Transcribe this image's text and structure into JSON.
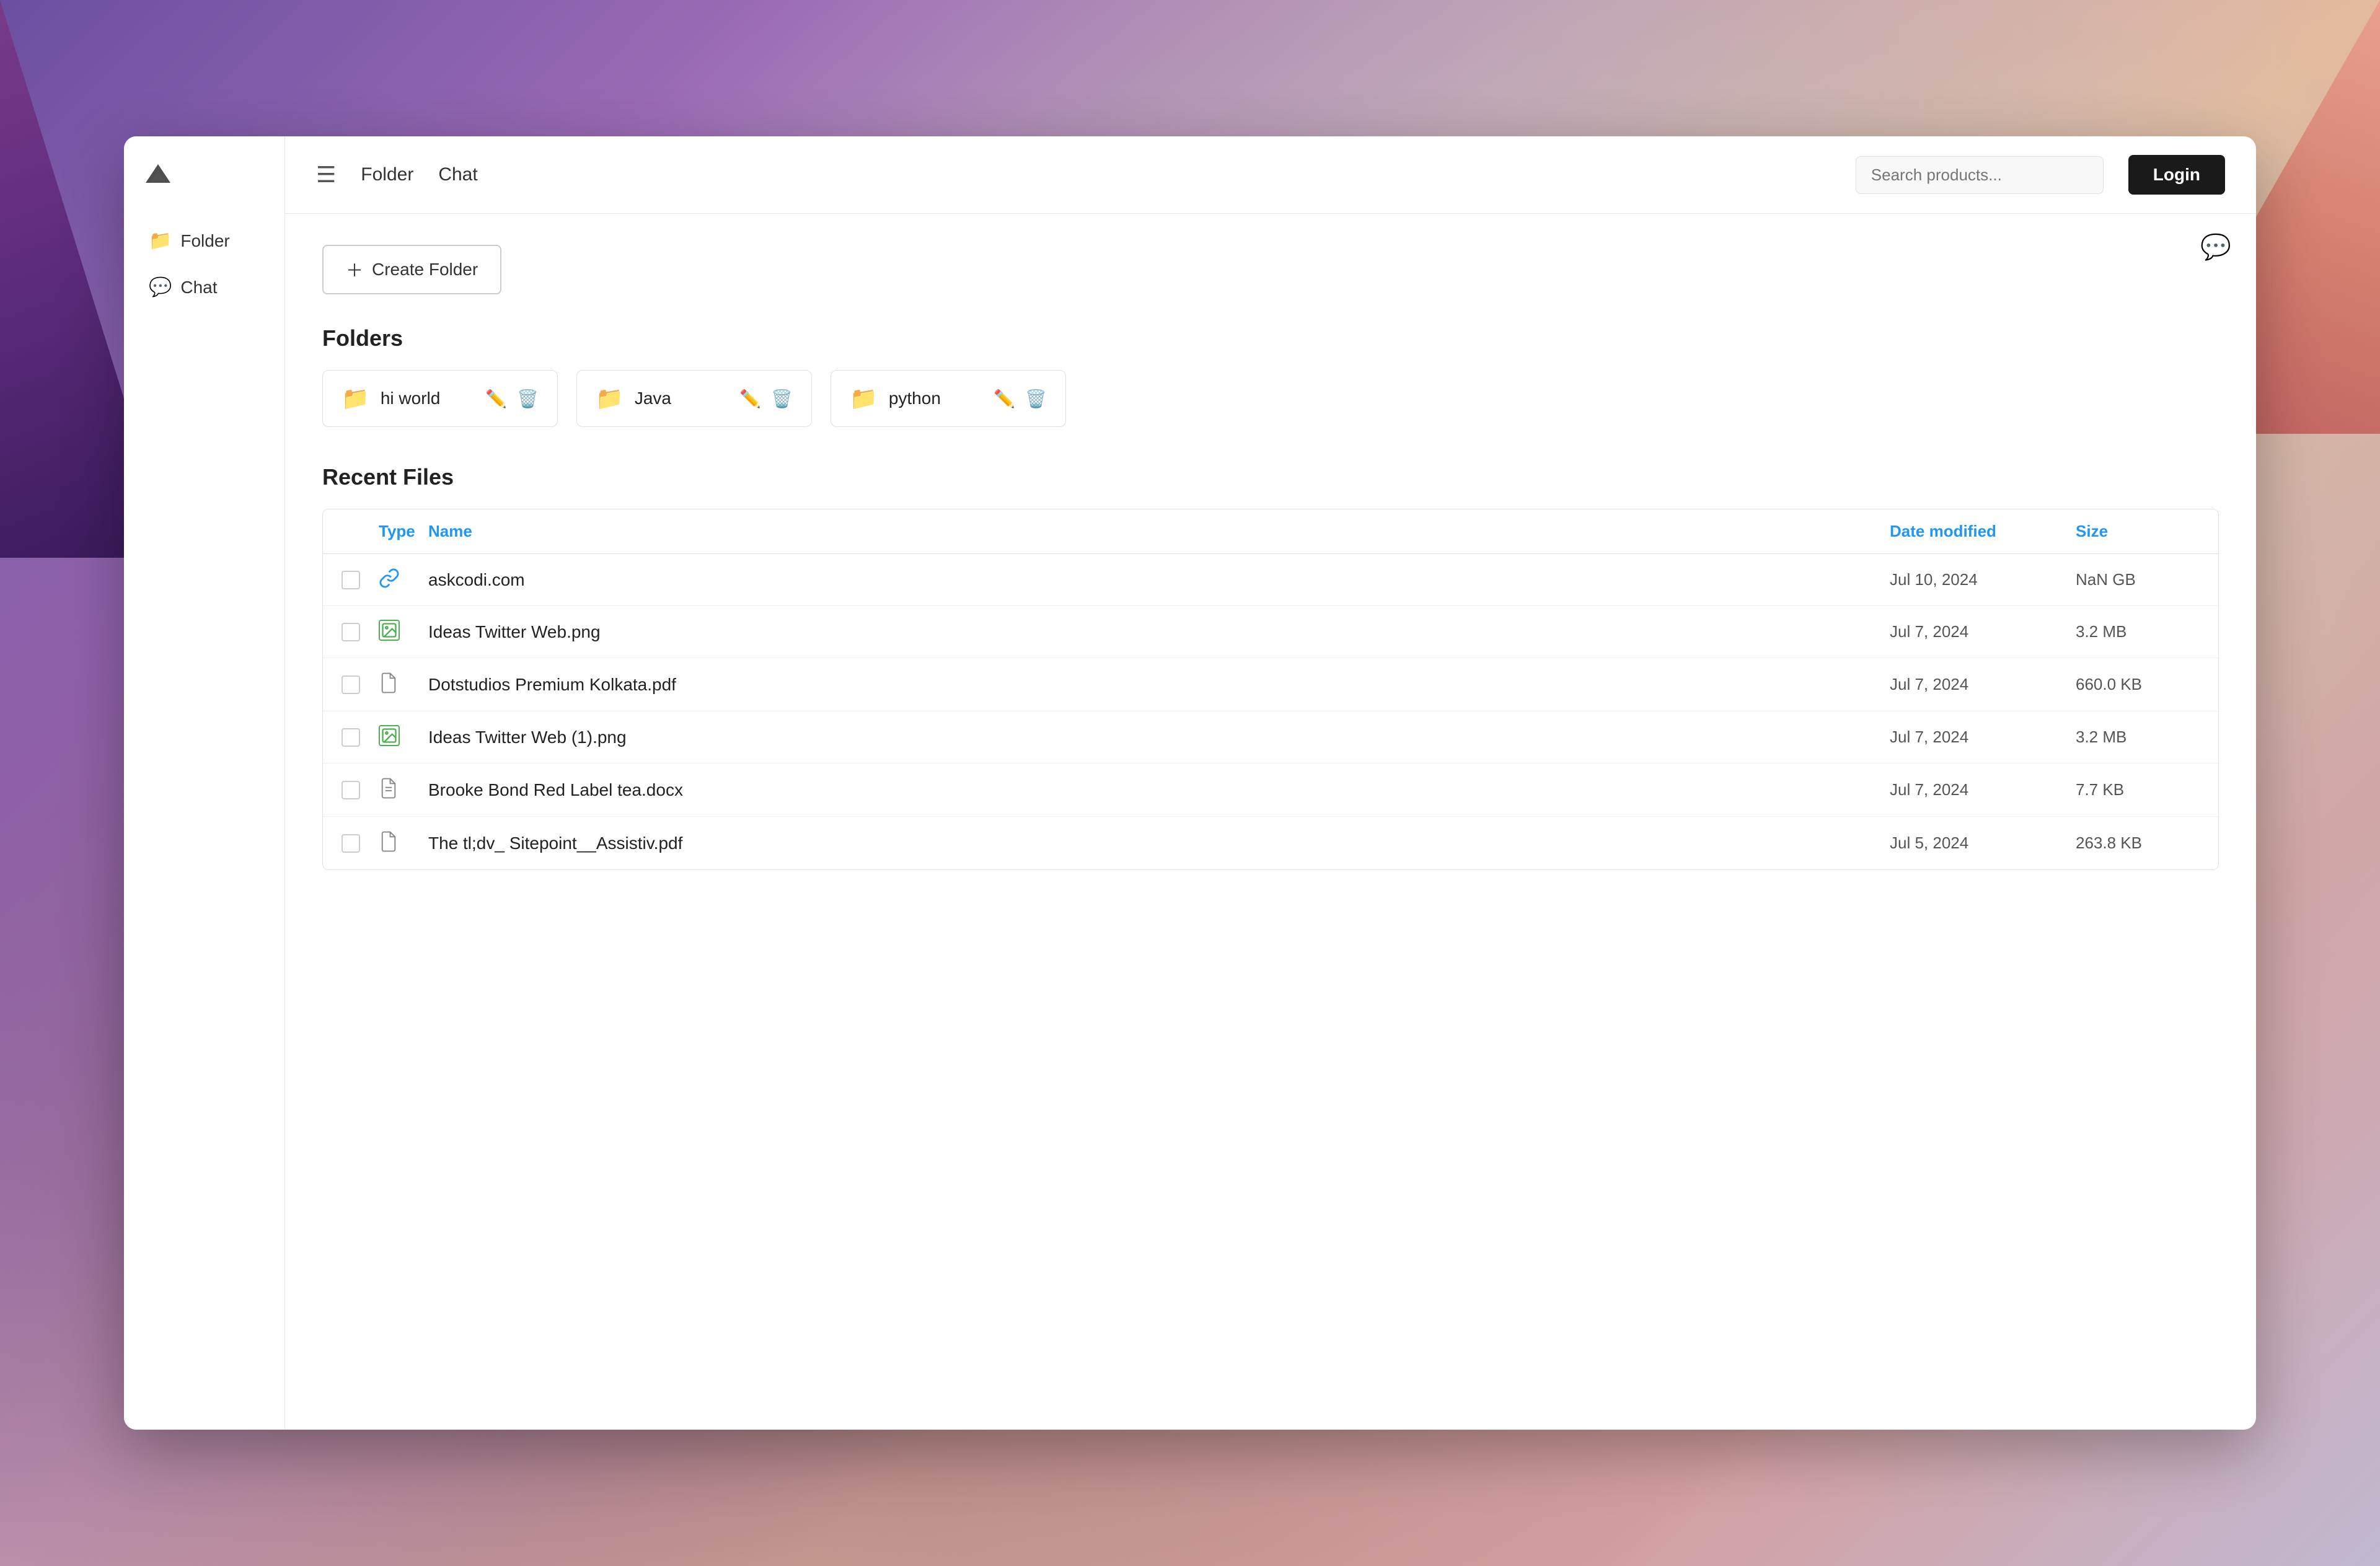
{
  "background": {
    "sky_color_top": "#8bbcbc",
    "sky_color_bottom": "#b8d4c0"
  },
  "app": {
    "logo_alt": "Mountain logo"
  },
  "sidebar": {
    "items": [
      {
        "id": "folder",
        "label": "Folder",
        "icon": "📁"
      },
      {
        "id": "chat",
        "label": "Chat",
        "icon": "💬"
      }
    ]
  },
  "header": {
    "menu_icon": "☰",
    "nav_items": [
      {
        "id": "folder",
        "label": "Folder"
      },
      {
        "id": "chat",
        "label": "Chat"
      }
    ],
    "search_placeholder": "Search products...",
    "login_label": "Login"
  },
  "page": {
    "chat_float_icon": "💬",
    "create_folder_label": "Create Folder",
    "folders_section_title": "Folders",
    "folders": [
      {
        "id": "hi-world",
        "name": "hi world",
        "icon": "📁"
      },
      {
        "id": "java",
        "name": "Java",
        "icon": "📁"
      },
      {
        "id": "python",
        "name": "python",
        "icon": "📁"
      }
    ],
    "recent_files_title": "Recent Files",
    "table_headers": {
      "type": "Type",
      "name": "Name",
      "date_modified": "Date modified",
      "size": "Size"
    },
    "files": [
      {
        "id": 1,
        "type": "link",
        "name": "askcodi.com",
        "date": "Jul 10, 2024",
        "size": "NaN GB"
      },
      {
        "id": 2,
        "type": "image",
        "name": "Ideas Twitter Web.png",
        "date": "Jul 7, 2024",
        "size": "3.2 MB"
      },
      {
        "id": 3,
        "type": "pdf",
        "name": "Dotstudios Premium Kolkata.pdf",
        "date": "Jul 7, 2024",
        "size": "660.0 KB"
      },
      {
        "id": 4,
        "type": "image",
        "name": "Ideas Twitter Web (1).png",
        "date": "Jul 7, 2024",
        "size": "3.2 MB"
      },
      {
        "id": 5,
        "type": "doc",
        "name": "Brooke Bond Red Label tea.docx",
        "date": "Jul 7, 2024",
        "size": "7.7 KB"
      },
      {
        "id": 6,
        "type": "pdf",
        "name": "The tl;dv_ Sitepoint__Assistiv.pdf",
        "date": "Jul 5, 2024",
        "size": "263.8 KB"
      }
    ]
  }
}
